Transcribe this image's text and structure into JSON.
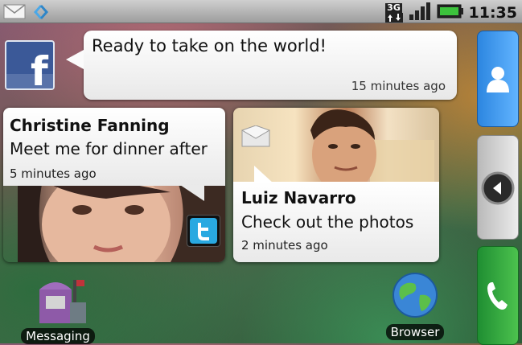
{
  "status_bar": {
    "network_type": "3G",
    "time": "11:35",
    "icons": [
      "email-icon",
      "sync-icon",
      "signal-icon",
      "battery-icon"
    ]
  },
  "facebook_widget": {
    "status_text": "Ready to take on the world!",
    "timestamp": "15 minutes ago",
    "logo_letter": "f"
  },
  "twitter_card": {
    "name": "Christine Fanning",
    "message": "Meet me for dinner after",
    "timestamp": "5 minutes ago"
  },
  "message_card": {
    "name": "Luiz Navarro",
    "message": "Check out the photos",
    "timestamp": "2 minutes ago"
  },
  "apps": [
    {
      "label": "Messaging",
      "icon": "mailbox-icon"
    },
    {
      "label": "Browser",
      "icon": "globe-icon"
    }
  ],
  "dock": [
    "contacts-icon",
    "back-arrow-icon",
    "phone-icon"
  ],
  "colors": {
    "facebook_blue": "#3b5998",
    "contacts_blue": "#2c86e0",
    "phone_green": "#2aa43a",
    "battery_green": "#3cc23c"
  }
}
